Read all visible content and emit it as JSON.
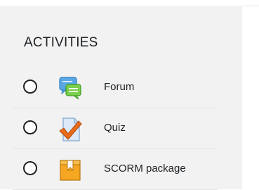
{
  "section": {
    "title": "ACTIVITIES"
  },
  "activities": [
    {
      "label": "Forum",
      "icon": "forum-icon"
    },
    {
      "label": "Quiz",
      "icon": "quiz-icon"
    },
    {
      "label": "SCORM package",
      "icon": "scorm-package-icon"
    }
  ]
}
